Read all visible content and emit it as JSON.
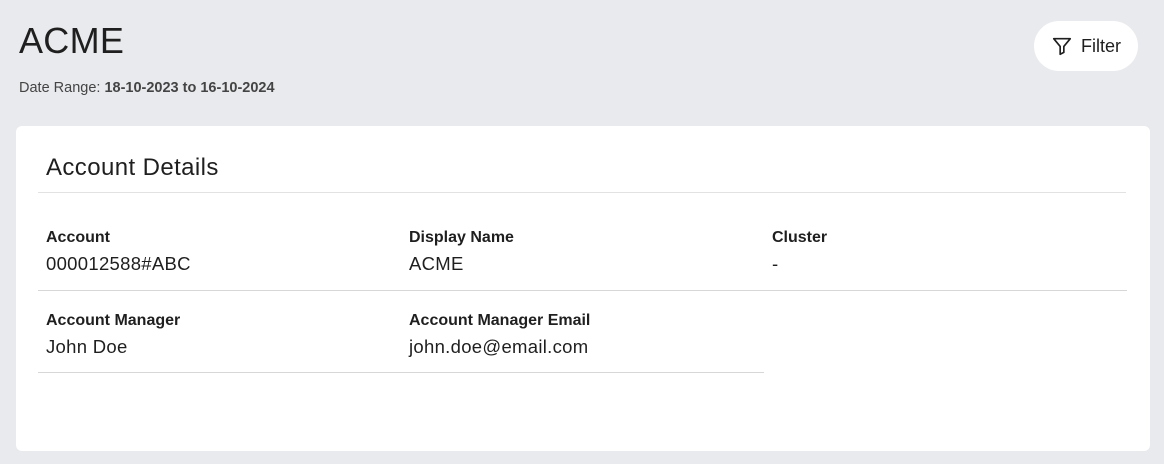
{
  "header": {
    "title": "ACME",
    "date_range_label": "Date Range:",
    "date_range_value": "18-10-2023 to 16-10-2024"
  },
  "filter_button": {
    "label": "Filter",
    "icon": "filter-icon"
  },
  "card": {
    "title": "Account Details",
    "fields": {
      "account": {
        "label": "Account",
        "value": "000012588#ABC"
      },
      "display_name": {
        "label": "Display Name",
        "value": "ACME"
      },
      "cluster": {
        "label": "Cluster",
        "value": "-"
      },
      "account_manager": {
        "label": "Account Manager",
        "value": "John Doe"
      },
      "account_manager_email": {
        "label": "Account Manager Email",
        "value": "john.doe@email.com"
      }
    }
  }
}
